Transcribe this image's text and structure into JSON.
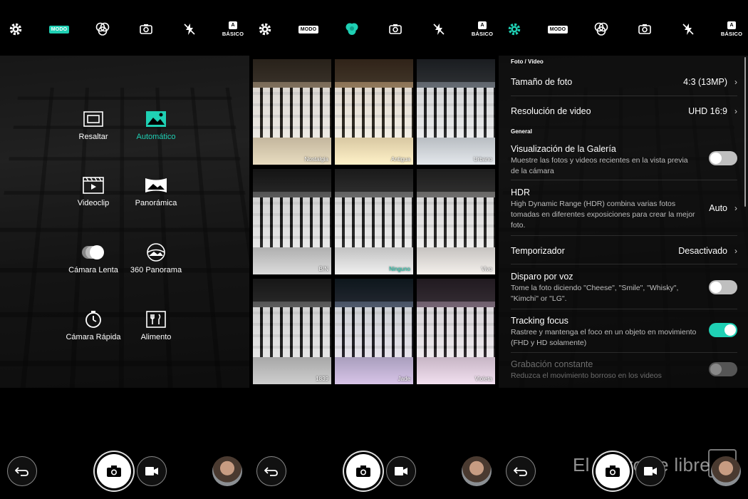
{
  "colors": {
    "accent": "#1fd0b4",
    "background": "#000000"
  },
  "toolbar": {
    "icons": [
      "gear-icon",
      "mode-badge",
      "filter-icon",
      "switch-camera-icon",
      "flash-off-icon",
      "basic-mode-icon"
    ],
    "mode_label": "MODO",
    "basic_badge": "A",
    "basic_label": "BÁSICO"
  },
  "modes": [
    {
      "label": "Resaltar",
      "icon": "highlight-icon",
      "selected": false
    },
    {
      "label": "Automático",
      "icon": "auto-icon",
      "selected": true
    },
    {
      "label": "Videoclip",
      "icon": "videoclip-icon",
      "selected": false
    },
    {
      "label": "Panorámica",
      "icon": "panorama-icon",
      "selected": false
    },
    {
      "label": "Cámara Lenta",
      "icon": "slow-motion-icon",
      "selected": false
    },
    {
      "label": "360 Panorama",
      "icon": "panorama-360-icon",
      "selected": false
    },
    {
      "label": "Cámara Rápida",
      "icon": "time-lapse-icon",
      "selected": false
    },
    {
      "label": "Alimento",
      "icon": "food-icon",
      "selected": false
    }
  ],
  "filters": [
    {
      "label": "Nostalgia",
      "selected": false
    },
    {
      "label": "Antigua",
      "selected": false
    },
    {
      "label": "Urbano",
      "selected": false
    },
    {
      "label": "B/N",
      "selected": false
    },
    {
      "label": "Ninguno",
      "selected": true
    },
    {
      "label": "Vivo",
      "selected": false
    },
    {
      "label": "1839",
      "selected": false
    },
    {
      "label": "Jade",
      "selected": false
    },
    {
      "label": "Violeta",
      "selected": false
    }
  ],
  "settings": {
    "section_photo": "Foto / Vídeo",
    "photo_size": {
      "title": "Tamaño de foto",
      "value": "4:3 (13MP)"
    },
    "video_res": {
      "title": "Resolución de video",
      "value": "UHD 16:9"
    },
    "section_general": "General",
    "gallery": {
      "title": "Visualización de la Galería",
      "desc": "Muestre las fotos y videos recientes en la vista previa de la cámara",
      "on": false
    },
    "hdr": {
      "title": "HDR",
      "desc": "High Dynamic Range (HDR) combina varias fotos tomadas en diferentes exposiciones para crear la mejor foto.",
      "value": "Auto"
    },
    "timer": {
      "title": "Temporizador",
      "value": "Desactivado"
    },
    "voice": {
      "title": "Disparo por voz",
      "desc": "Tome la foto diciendo \"Cheese\", \"Smile\", \"Whisky\", \"Kimchi\" or \"LG\".",
      "on": false
    },
    "tracking": {
      "title": "Tracking focus",
      "desc": "Rastree y mantenga el foco en un objeto en movimiento (FHD y HD solamente)",
      "on": true
    },
    "steady": {
      "title": "Grabación constante",
      "desc": "Reduzca el movimiento borroso en los videos",
      "on": false,
      "disabled": true
    }
  },
  "watermark": "El androide libre"
}
